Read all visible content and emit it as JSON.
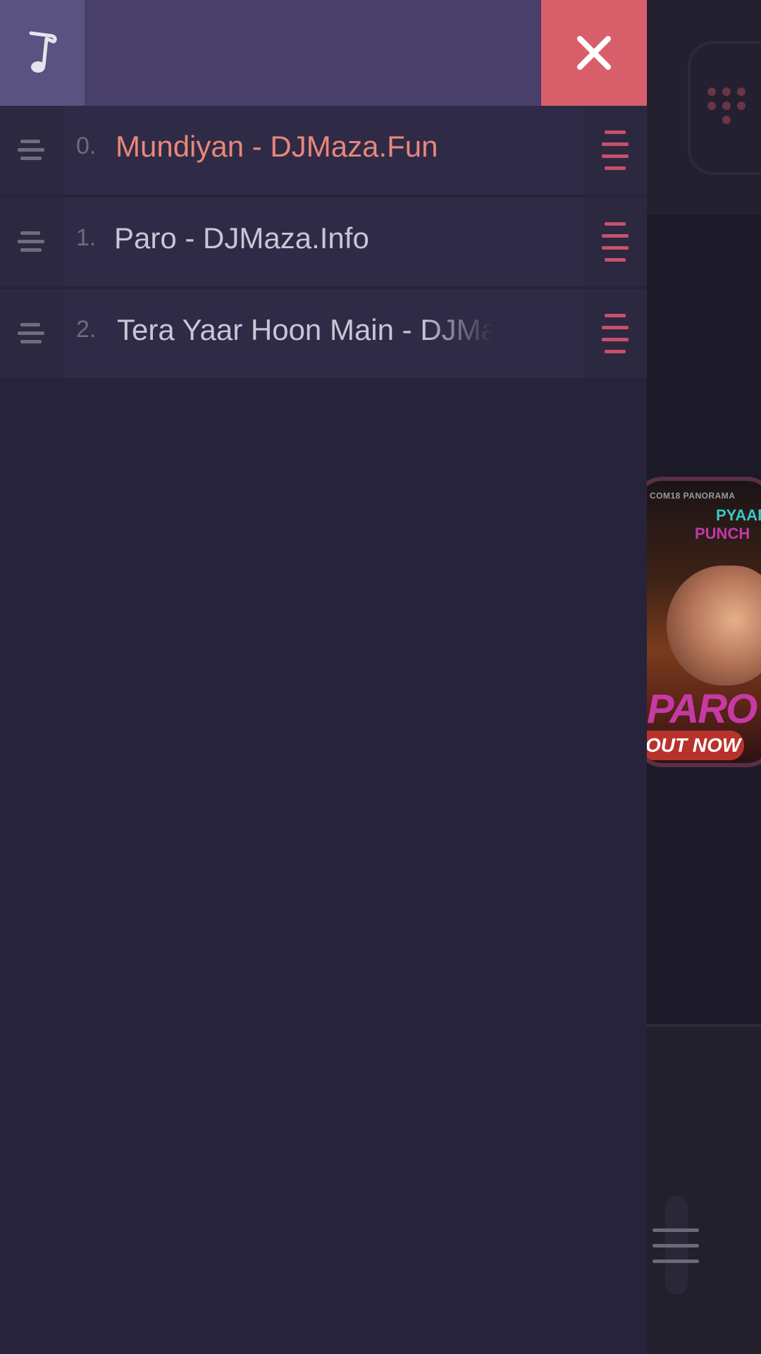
{
  "drawer": {
    "header": {
      "note_icon": "music-note-icon",
      "close_icon": "close-icon"
    },
    "tracks": [
      {
        "index": "0.",
        "title": "Mundiyan - DJMaza.Fun",
        "active": true
      },
      {
        "index": "1.",
        "title": "Paro - DJMaza.Info",
        "active": false
      },
      {
        "index": "2.",
        "title": "Tera Yaar Hoon Main - DJMaz",
        "active": false
      }
    ]
  },
  "background": {
    "album_art": {
      "logos": "COM18   PANORAMA",
      "line1": "PYAAR",
      "line2": "PUNCH",
      "title": "PARO",
      "badge": "OUT NOW"
    }
  },
  "colors": {
    "accent": "#d85f6a",
    "active_track": "#e8877a",
    "header": "#483f6b",
    "drawer_bg": "#27233b"
  }
}
